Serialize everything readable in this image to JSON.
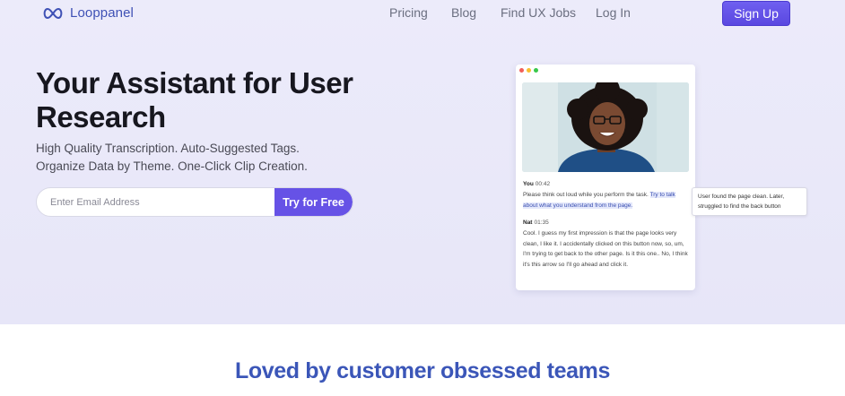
{
  "nav": {
    "logo_text": "Looppanel",
    "links": [
      "Pricing",
      "Blog",
      "Find UX Jobs",
      "Log In"
    ],
    "signup_label": "Sign Up"
  },
  "hero": {
    "headline": "Your Assistant for User Research",
    "sub_line1": "High Quality Transcription. Auto-Suggested Tags.",
    "sub_line2": "Organize Data by Theme. One-Click Clip Creation.",
    "email_placeholder": "Enter Email Address",
    "cta_label": "Try for Free"
  },
  "mock": {
    "dot_colors": [
      "#f25f58",
      "#f9be2e",
      "#38c84a"
    ],
    "entry1": {
      "speaker": "You",
      "time": "00:42",
      "text_plain": "Please think out loud while you perform the task. ",
      "text_highlight": "Try to talk about what you understand from the page."
    },
    "entry2": {
      "speaker": "Nat",
      "time": "01:35",
      "text": "Cool. I guess my first impression is that the page looks very clean, I like it. I accidentally clicked on this button now, so, um, I'm trying to get back to the other page. Is it this one.. No, I think it's this arrow so I'll go ahead and click it."
    },
    "tooltip": "User found the page clean. Later, struggled to find the back button"
  },
  "section": {
    "title": "Loved by customer obsessed teams"
  },
  "colors": {
    "brand": "#3f51b5",
    "accent": "#6652e6",
    "hero_bg": "#ecebfa"
  }
}
